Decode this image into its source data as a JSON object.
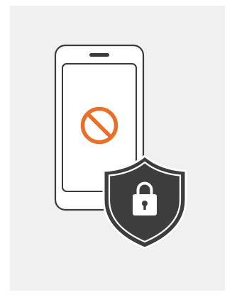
{
  "illustration": {
    "subject": "phone-blocked-with-security-shield",
    "icons": [
      "smartphone-icon",
      "prohibited-icon",
      "security-shield-icon",
      "padlock-icon"
    ],
    "colors": {
      "background": "#f0f0f0",
      "page": "#ffffff",
      "phone_outline": "#3a3a3a",
      "phone_fill": "#ffffff",
      "prohibited": "#e8702a",
      "shield_fill": "#3d3d3d",
      "shield_border": "#ffffff",
      "lock": "#ffffff"
    }
  }
}
